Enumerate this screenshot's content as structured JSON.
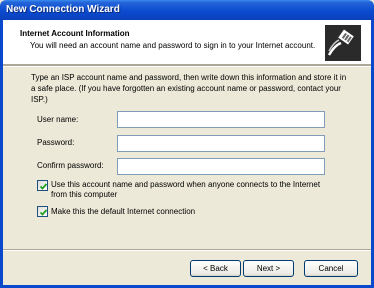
{
  "window": {
    "title": "New Connection Wizard"
  },
  "header": {
    "title": "Internet Account Information",
    "subtitle": "You will need an account name and password to sign in to your Internet account."
  },
  "intro": "Type an ISP account name and password, then write down this information and store it in a safe place. (If you have forgotten an existing account name or password, contact your ISP.)",
  "form": {
    "user_name_label": "User name:",
    "user_name_value": "",
    "password_label": "Password:",
    "password_value": "",
    "confirm_password_label": "Confirm password:",
    "confirm_password_value": ""
  },
  "options": {
    "use_for_anyone_label": "Use this account  name and password when anyone connects to the Internet from this computer",
    "use_for_anyone_checked": true,
    "default_connection_label": "Make this the default Internet connection",
    "default_connection_checked": true
  },
  "buttons": {
    "back": "< Back",
    "next": "Next >",
    "cancel": "Cancel"
  },
  "icons": {
    "header": "network-cable-icon",
    "checkmark": "checkmark-icon"
  },
  "colors": {
    "titlebar": "#0a48cc",
    "background": "#ece9d8",
    "field_border": "#7f9db9"
  }
}
